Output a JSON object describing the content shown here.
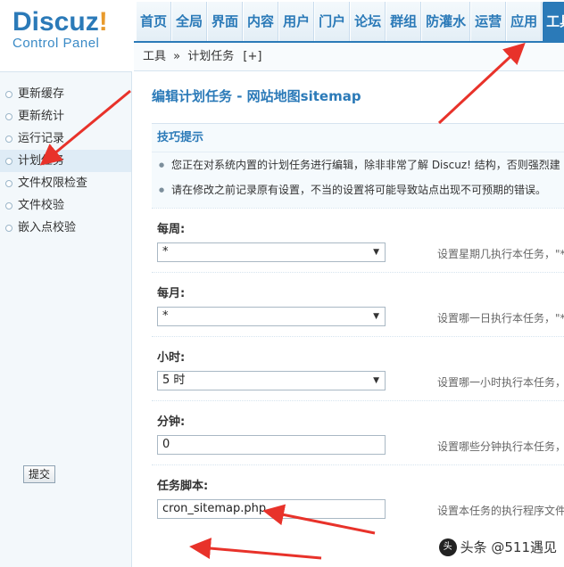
{
  "logo": {
    "main": "Discuz",
    "bang": "!",
    "sub": "Control Panel"
  },
  "topnav": {
    "items": [
      "首页",
      "全局",
      "界面",
      "内容",
      "用户",
      "门户",
      "论坛",
      "群组",
      "防灌水",
      "运营",
      "应用",
      "工具"
    ],
    "active_index": 11
  },
  "breadcrumb": {
    "section": "工具",
    "sep": "»",
    "page": "计划任务",
    "add": "[+]"
  },
  "sidebar": {
    "items": [
      "更新缓存",
      "更新统计",
      "运行记录",
      "计划任务",
      "文件权限检查",
      "文件校验",
      "嵌入点校验"
    ],
    "active_index": 3
  },
  "main": {
    "title": "编辑计划任务 - 网站地图sitemap",
    "tips_title": "技巧提示",
    "tips": [
      "您正在对系统内置的计划任务进行编辑，除非非常了解 Discuz! 结构，否则强烈建",
      "请在修改之前记录原有设置，不当的设置将可能导致站点出现不可预期的错误。"
    ],
    "fields": {
      "weekday": {
        "label": "每周:",
        "value": "*",
        "hint": "设置星期几执行本任务，\"*"
      },
      "day": {
        "label": "每月:",
        "value": "*",
        "hint": "设置哪一日执行本任务，\"*"
      },
      "hour": {
        "label": "小时:",
        "value": "5 时",
        "hint": "设置哪一小时执行本任务，"
      },
      "minute": {
        "label": "分钟:",
        "value": "0",
        "hint": "设置哪些分钟执行本任务，"
      },
      "script": {
        "label": "任务脚本:",
        "value": "cron_sitemap.php",
        "hint": "设置本任务的执行程序文件"
      }
    },
    "submit_label": "提交"
  },
  "watermark": {
    "text": "头条 @511遇见",
    "icon": "toutiao-icon"
  },
  "colors": {
    "accent": "#2b7ab8",
    "arrow": "#e8322a"
  }
}
